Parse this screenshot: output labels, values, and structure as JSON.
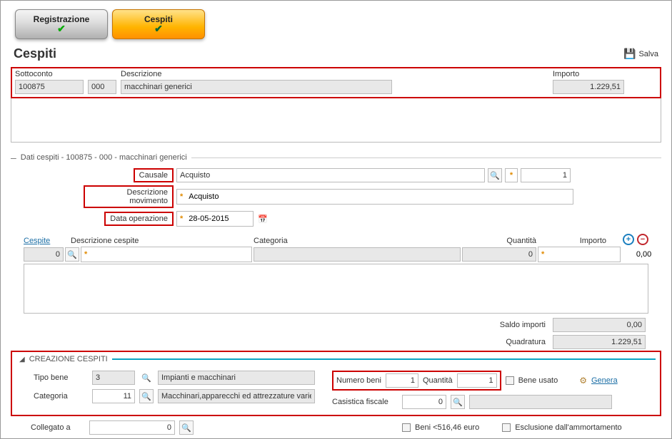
{
  "tabs": {
    "registrazione": "Registrazione",
    "cespiti": "Cespiti"
  },
  "title": "Cespiti",
  "save": "Salva",
  "top": {
    "h_sottoconto": "Sottoconto",
    "h_descr": "Descrizione",
    "h_importo": "Importo",
    "sottoconto": "100875",
    "sub": "000",
    "descr": "macchinari generici",
    "importo": "1.229,51"
  },
  "section1_label": "Dati cespiti - 100875 - 000 - macchinari generici",
  "mid": {
    "lbl_causale": "Causale",
    "causale": "Acquisto",
    "causale_n": "1",
    "lbl_descr_mov": "Descrizione movimento",
    "descr_mov": "Acquisto",
    "lbl_data_op": "Data operazione",
    "data_op": "28-05-2015"
  },
  "grid": {
    "h_cespite": "Cespite",
    "h_descr_cespite": "Descrizione cespite",
    "h_categoria": "Categoria",
    "h_quantita": "Quantità",
    "h_importo": "Importo",
    "row": {
      "cespite": "0",
      "descr": "",
      "cat": "",
      "qty": "0",
      "imp": "0,00"
    }
  },
  "totals": {
    "lbl_saldo": "Saldo importi",
    "saldo": "0,00",
    "lbl_quad": "Quadratura",
    "quad": "1.229,51"
  },
  "cc": {
    "heading": "CREAZIONE CESPITI",
    "lbl_tipo": "Tipo bene",
    "tipo_n": "3",
    "tipo_descr": "Impianti e macchinari",
    "lbl_cat": "Categoria",
    "cat_n": "11",
    "cat_descr": "Macchinari,apparecchi ed attrezzature varie",
    "lbl_num_beni": "Numero beni",
    "num_beni": "1",
    "lbl_qty": "Quantità",
    "qty": "1",
    "lbl_bene_usato": "Bene usato",
    "lbl_genera": "Genera",
    "lbl_casistica": "Casistica fiscale",
    "casistica_n": "0",
    "lbl_collegato": "Collegato a",
    "collegato_n": "0",
    "lbl_beni516": "Beni <516,46 euro",
    "lbl_escl": "Esclusione dall'ammortamento"
  }
}
